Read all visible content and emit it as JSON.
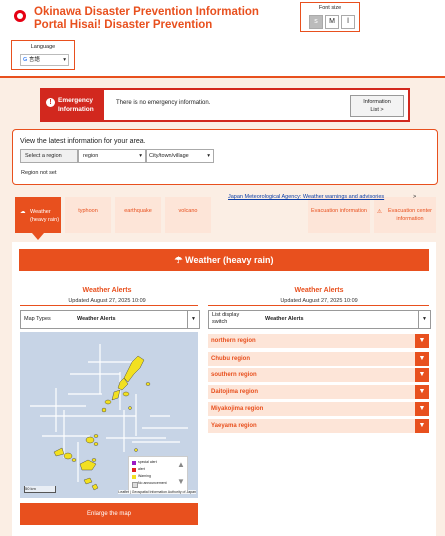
{
  "header": {
    "title_line1": "Okinawa Disaster Prevention Information",
    "title_line2": "Portal Hisai! Disaster Prevention",
    "font_size": {
      "label": "Font size",
      "small": "s",
      "medium": "M",
      "large": "l"
    },
    "language": {
      "label": "Language",
      "value": "言語"
    }
  },
  "emergency": {
    "tag": "Emergency Information",
    "message": "There is no emergency information.",
    "list_button": "Information List >"
  },
  "area": {
    "heading": "View the latest information for your area.",
    "select_label": "Select a region",
    "region_select": "region",
    "city_select": "City/town/village",
    "status": "Region not set"
  },
  "tabs": [
    {
      "label": "Weather (heavy rain)",
      "active": true
    },
    {
      "label": "typhoon"
    },
    {
      "label": "earthquake"
    },
    {
      "label": "volcano"
    },
    {
      "label": "Evacuation information"
    },
    {
      "label": "Evacuation center information"
    }
  ],
  "panel": {
    "title": "Weather (heavy rain)",
    "left": {
      "heading": "Weather Alerts",
      "updated": "Updated August 27, 2025 10:09",
      "dropdown_label": "Map Types",
      "dropdown_value": "Weather Alerts"
    },
    "right": {
      "heading": "Weather Alerts",
      "updated": "Updated August 27, 2025 10:09",
      "dropdown_label": "List display switch",
      "dropdown_value": "Weather Alerts"
    },
    "regions": [
      "northern region",
      "Chubu region",
      "southern region",
      "Daitojima region",
      "Miyakojima region",
      "Yaeyama region"
    ],
    "jma_link": "Japan Meteorological Agency: Weather warnings and advisories",
    "enlarge_button": "Enlarge the map",
    "map": {
      "scale": "50 km",
      "attribution": "Leaflet | Geospatial Information Authority of Japan",
      "legend": [
        {
          "label": "special alert",
          "color": "#9b19c4"
        },
        {
          "label": "alert",
          "color": "#e02020"
        },
        {
          "label": "Warning",
          "color": "#f2e020"
        },
        {
          "label": "No announcement",
          "color": "#dddddd"
        }
      ]
    }
  },
  "colors": {
    "accent": "#e8501e",
    "emergency": "#d2281e",
    "land_warning": "#f2e020"
  }
}
